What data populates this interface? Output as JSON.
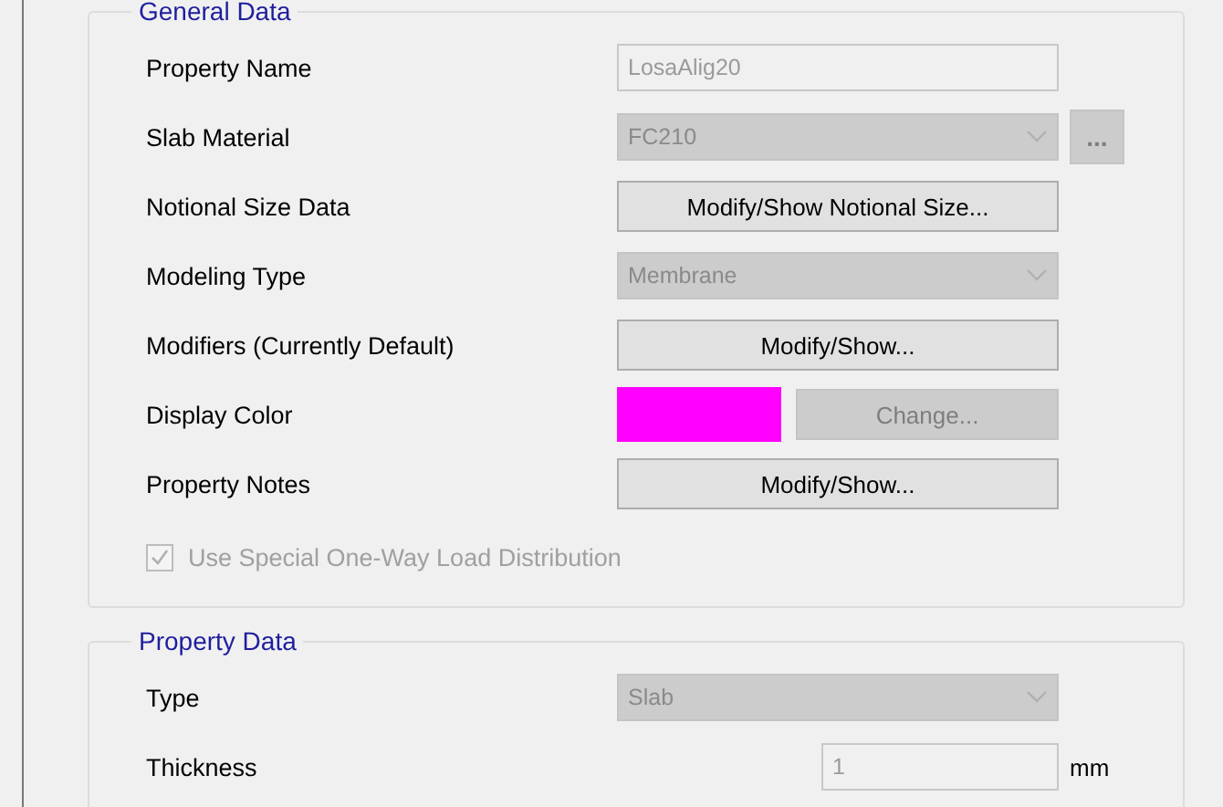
{
  "general_data": {
    "title": "General Data",
    "rows": [
      {
        "kind": "text",
        "label": "Property Name",
        "value": "LosaAlig20",
        "disabled": true
      },
      {
        "kind": "combo",
        "label": "Slab Material",
        "value": "FC210",
        "disabled": true,
        "extra_button": {
          "label": "...",
          "disabled": true
        }
      },
      {
        "kind": "button",
        "label": "Notional Size Data",
        "button": "Modify/Show Notional Size...",
        "disabled": false
      },
      {
        "kind": "combo",
        "label": "Modeling Type",
        "value": "Membrane",
        "disabled": true
      },
      {
        "kind": "button",
        "label": "Modifiers (Currently Default)",
        "button": "Modify/Show...",
        "disabled": false
      },
      {
        "kind": "color",
        "label": "Display Color",
        "color": "#ff00ff",
        "button": "Change...",
        "disabled": true
      },
      {
        "kind": "button",
        "label": "Property Notes",
        "button": "Modify/Show...",
        "disabled": false
      }
    ],
    "checkbox": {
      "label": "Use Special One-Way Load Distribution",
      "checked": true,
      "disabled": true
    }
  },
  "property_data": {
    "title": "Property Data",
    "rows": [
      {
        "kind": "combo",
        "label": "Type",
        "value": "Slab",
        "disabled": true
      },
      {
        "kind": "number",
        "label": "Thickness",
        "value": "1",
        "unit": "mm",
        "disabled": true
      }
    ]
  }
}
